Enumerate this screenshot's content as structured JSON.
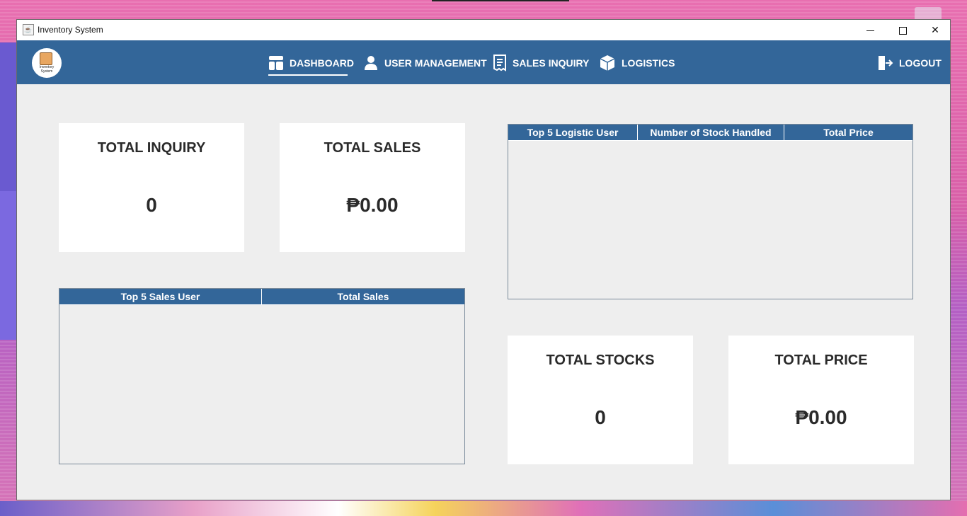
{
  "window": {
    "title": "Inventory System"
  },
  "navbar": {
    "logo_text_line1": "Inventory",
    "logo_text_line2": "System",
    "items": [
      {
        "label": "DASHBOARD",
        "icon": "dashboard-icon",
        "active": true
      },
      {
        "label": "USER MANAGEMENT",
        "icon": "user-icon",
        "active": false
      },
      {
        "label": "SALES INQUIRY",
        "icon": "receipt-icon",
        "active": false
      },
      {
        "label": "LOGISTICS",
        "icon": "box-icon",
        "active": false
      }
    ],
    "logout_label": "LOGOUT"
  },
  "cards": {
    "total_inquiry": {
      "title": "TOTAL INQUIRY",
      "value": "0"
    },
    "total_sales": {
      "title": "TOTAL SALES",
      "value": "₱0.00"
    },
    "total_stocks": {
      "title": "TOTAL STOCKS",
      "value": "0"
    },
    "total_price": {
      "title": "TOTAL PRICE",
      "value": "₱0.00"
    }
  },
  "tables": {
    "logistics": {
      "columns": [
        "Top 5 Logistic User",
        "Number of Stock Handled",
        "Total Price"
      ],
      "rows": []
    },
    "sales": {
      "columns": [
        "Top 5 Sales User",
        "Total Sales"
      ],
      "rows": []
    }
  },
  "colors": {
    "nav_bg": "#336699",
    "header_bg": "#336699",
    "content_bg": "#eeeeee",
    "card_bg": "#ffffff"
  }
}
